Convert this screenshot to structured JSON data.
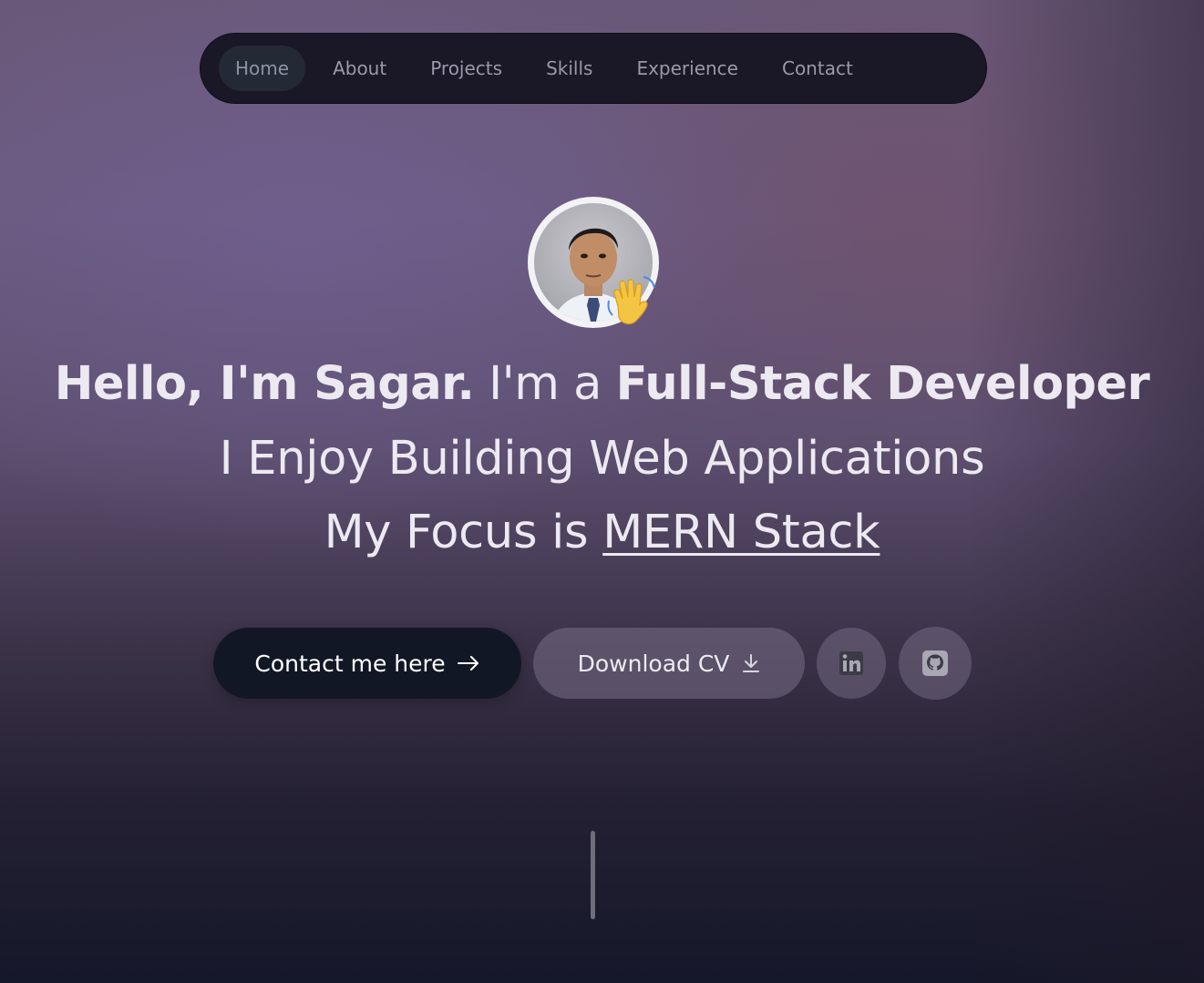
{
  "nav": {
    "items": [
      {
        "label": "Home",
        "active": true
      },
      {
        "label": "About"
      },
      {
        "label": "Projects"
      },
      {
        "label": "Skills"
      },
      {
        "label": "Experience"
      },
      {
        "label": "Contact"
      }
    ]
  },
  "hero": {
    "greeting_bold": "Hello, I'm Sagar.",
    "greeting_mid": "I'm a",
    "role": "Full-Stack Developer",
    "line2": "I Enjoy Building Web Applications",
    "line3_prefix": "My Focus is",
    "line3_focus": "MERN Stack"
  },
  "actions": {
    "contact_label": "Contact me here",
    "contact_icon": "arrow-right-icon",
    "cv_label": "Download CV",
    "cv_icon": "download-icon",
    "linkedin_icon": "linkedin-icon",
    "github_icon": "github-icon"
  },
  "colors": {
    "nav_bg": "#1a1727",
    "primary_button": "#121726",
    "text": "#ece9f0"
  }
}
